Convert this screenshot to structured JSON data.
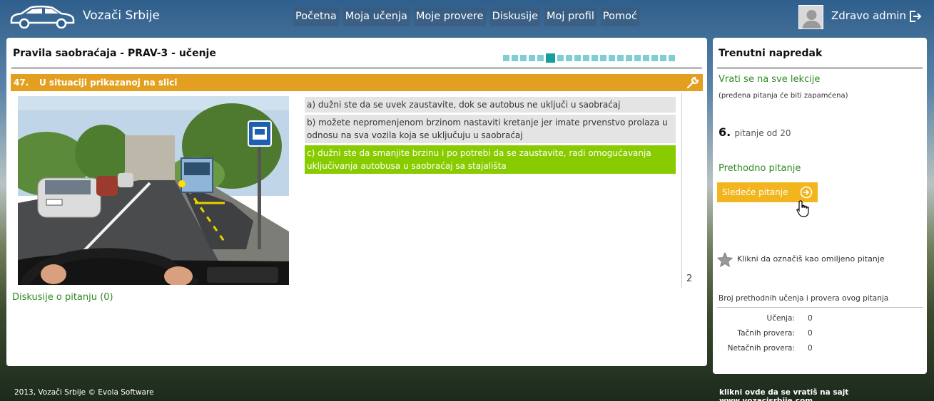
{
  "header": {
    "brand": "Vozači Srbije",
    "nav": [
      "Početna",
      "Moja učenja",
      "Moje provere",
      "Diskusije",
      "Moj profil",
      "Pomoć"
    ],
    "greeting": "Zdravo admin"
  },
  "main": {
    "lesson_title": "Pravila saobraćaja - PRAV-3 - učenje",
    "progress": {
      "total": 20,
      "current": 6
    },
    "question": {
      "number": "47.",
      "text": "U situaciji prikazanoj na slici",
      "answers": [
        {
          "text": "a) dužni ste da se uvek zaustavite, dok se autobus ne uključi u saobraćaj",
          "correct": false
        },
        {
          "text": "b) možete nepromenjenom brzinom nastaviti kretanje jer imate prvenstvo prolaza u odnosu na sva vozila koja se uključuju u saobraćaj",
          "correct": false
        },
        {
          "text": "c) dužni ste da smanjite brzinu i po potrebi da se zaustavite, radi omogućavanja uključivanja autobusa u saobraćaj sa stajališta",
          "correct": true
        }
      ],
      "points": "2"
    },
    "discuss_link": "Diskusije o pitanju (0)"
  },
  "side": {
    "title": "Trenutni napredak",
    "back_link": "Vrati se na sve lekcije",
    "saved_note": "(pređena pitanja će biti zapamćena)",
    "qpos_num": "6.",
    "qpos_text": "pitanje od 20",
    "prev_link": "Prethodno pitanje",
    "next_btn": "Sledeće pitanje",
    "fav_text": "Klikni da označiš kao omiljeno pitanje",
    "stats_title": "Broj prethodnih učenja i provera ovog pitanja",
    "stats": [
      {
        "label": "Učenja:",
        "value": "0"
      },
      {
        "label": "Tačnih provera:",
        "value": "0"
      },
      {
        "label": "Netačnih provera:",
        "value": "0"
      }
    ]
  },
  "footer": {
    "left": "2013, Vozači Srbije © Evola Software",
    "right": "klikni ovde da se vratiš na sajt  www.vozacisrbije.com"
  }
}
